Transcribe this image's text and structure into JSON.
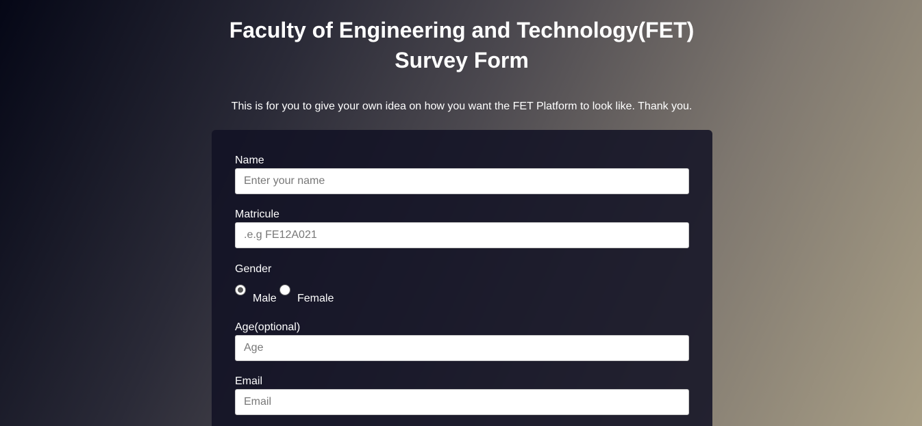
{
  "header": {
    "title_line1": "Faculty of Engineering and Technology(FET)",
    "title_line2": "Survey Form",
    "description": "This is for you to give your own idea on how you want the FET Platform to look like. Thank you."
  },
  "form": {
    "name": {
      "label": "Name",
      "placeholder": "Enter your name",
      "value": ""
    },
    "matricule": {
      "label": "Matricule",
      "placeholder": ".e.g FE12A021",
      "value": ""
    },
    "gender": {
      "label": "Gender",
      "options": [
        {
          "label": "Male",
          "checked": true
        },
        {
          "label": "Female",
          "checked": false
        }
      ]
    },
    "age": {
      "label": "Age(optional)",
      "placeholder": "Age",
      "value": ""
    },
    "email": {
      "label": "Email",
      "placeholder": "Email",
      "value": ""
    }
  },
  "colors": {
    "background_start": "#050716",
    "background_end": "#a99f86",
    "card_background": "#111224",
    "text_primary": "#ffffff",
    "input_background": "#ffffff",
    "placeholder": "#777777"
  }
}
